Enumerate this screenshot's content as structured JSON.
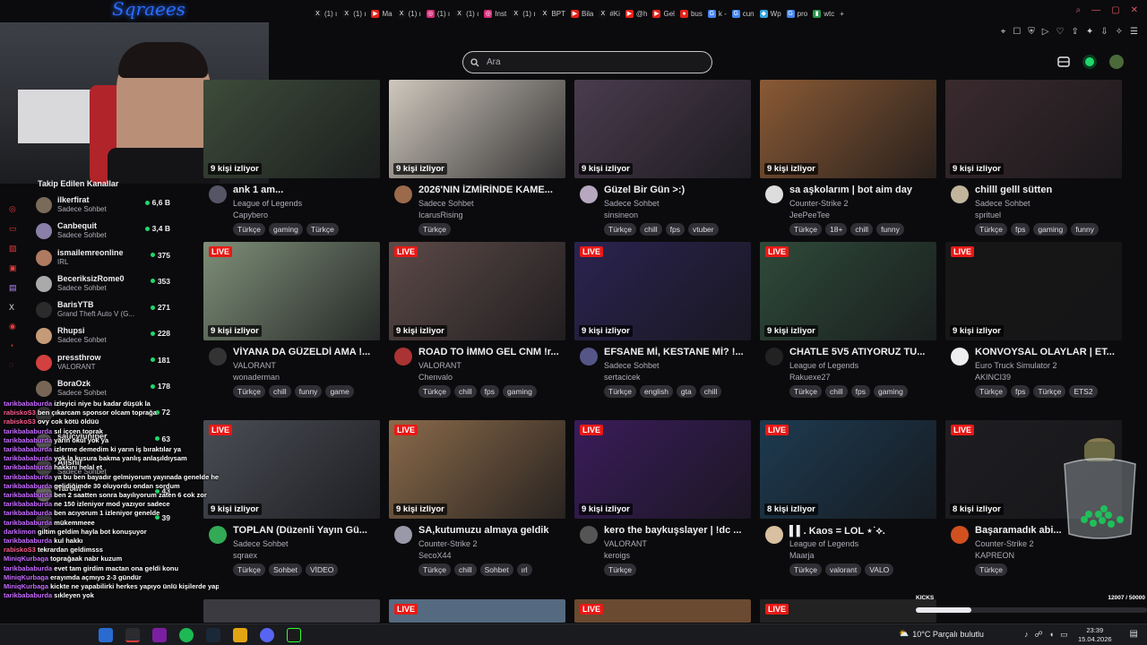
{
  "overlay": {
    "logo_text": "Sqraees"
  },
  "browser_tabs": [
    {
      "label": "(1) ı",
      "fav": "X",
      "color": "#111"
    },
    {
      "label": "(1) ı",
      "fav": "X",
      "color": "#111"
    },
    {
      "label": "Ma",
      "fav": "▶",
      "color": "#e62117"
    },
    {
      "label": "(1) ı",
      "fav": "X",
      "color": "#111"
    },
    {
      "label": "(1) ı",
      "fav": "◎",
      "color": "#d62976"
    },
    {
      "label": "(1) ı",
      "fav": "X",
      "color": "#111"
    },
    {
      "label": "Inst",
      "fav": "◎",
      "color": "#d62976"
    },
    {
      "label": "(1) ı",
      "fav": "X",
      "color": "#111"
    },
    {
      "label": "BPT",
      "fav": "X",
      "color": "#111"
    },
    {
      "label": "Bila",
      "fav": "▶",
      "color": "#e62117"
    },
    {
      "label": "#Ki",
      "fav": "X",
      "color": "#111"
    },
    {
      "label": "@h",
      "fav": "▶",
      "color": "#e62117"
    },
    {
      "label": "Gel",
      "fav": "▶",
      "color": "#e62117"
    },
    {
      "label": "bus",
      "fav": "●",
      "color": "#e62117"
    },
    {
      "label": "k -",
      "fav": "G",
      "color": "#4285f4"
    },
    {
      "label": "cun",
      "fav": "G",
      "color": "#4285f4"
    },
    {
      "label": "Wp",
      "fav": "◆",
      "color": "#33a3dc"
    },
    {
      "label": "pro",
      "fav": "G",
      "color": "#4285f4"
    },
    {
      "label": "wtc",
      "fav": "▮",
      "color": "#2b9348"
    }
  ],
  "search": {
    "placeholder": "Ara"
  },
  "followed": {
    "title": "Takip Edilen Kanallar",
    "channels": [
      {
        "name": "ilkerfirat",
        "category": "Sadece Sohbet",
        "viewers": "6,6 B",
        "color": "#7a6a5a"
      },
      {
        "name": "Canbequit",
        "category": "Sadece Sohbet",
        "viewers": "3,4 B",
        "color": "#8a7fa8"
      },
      {
        "name": "ismailemreonline",
        "category": "IRL",
        "viewers": "375",
        "color": "#b07a60"
      },
      {
        "name": "BeceriksizRome0",
        "category": "Sadece Sohbet",
        "viewers": "353",
        "color": "#aaaaaa"
      },
      {
        "name": "BarisYTB",
        "category": "Grand Theft Auto V (G...",
        "viewers": "271",
        "color": "#2b2b2b"
      },
      {
        "name": "Rhupsi",
        "category": "Sadece Sohbet",
        "viewers": "228",
        "color": "#c59a78"
      },
      {
        "name": "pressthrow",
        "category": "VALORANT",
        "viewers": "181",
        "color": "#d24040"
      },
      {
        "name": "BoraOzk",
        "category": "Sadece Sohbet",
        "viewers": "178",
        "color": "#776655"
      },
      {
        "name": "",
        "category": "",
        "viewers": "72",
        "color": "#333"
      },
      {
        "name": "saucyjuniper",
        "category": "",
        "viewers": "63",
        "color": "#555"
      },
      {
        "name": "Alisnir",
        "category": "Sadece Sohbet",
        "viewers": "",
        "color": "#444"
      },
      {
        "name": "Tarcin",
        "category": "",
        "viewers": "43",
        "color": "#666"
      },
      {
        "name": "",
        "category": "",
        "viewers": "39",
        "color": "#333"
      }
    ]
  },
  "streams": [
    {
      "live": false,
      "viewers": "9 kişi izliyor",
      "title": "ank 1 am...",
      "category": "League of Legends",
      "channel": "Capybero",
      "tags": [
        "Türkçe",
        "gaming",
        "Türkçe"
      ],
      "thumb": "#3d4c3a",
      "avatar": "#556"
    },
    {
      "live": false,
      "viewers": "9 kişi izliyor",
      "title": "2026'NIN İZMİRİNDE KAME...",
      "category": "Sadece Sohbet",
      "channel": "IcarusRising",
      "tags": [
        "Türkçe"
      ],
      "thumb": "#cfc8bd",
      "avatar": "#9a6a4a"
    },
    {
      "live": false,
      "viewers": "9 kişi izliyor",
      "title": "Güzel Bir Gün >:)",
      "category": "Sadece Sohbet",
      "channel": "sinsineon",
      "tags": [
        "Türkçe",
        "chill",
        "fps",
        "vtuber"
      ],
      "thumb": "#4a3c4e",
      "avatar": "#b7a8c0"
    },
    {
      "live": false,
      "viewers": "9 kişi izliyor",
      "title": "sa aşkolarım | bot aim day",
      "category": "Counter-Strike 2",
      "channel": "JeePeeTee",
      "tags": [
        "Türkçe",
        "18+",
        "chill",
        "funny"
      ],
      "thumb": "#8a5a35",
      "avatar": "#ddd"
    },
    {
      "live": false,
      "viewers": "9 kişi izliyor",
      "title": "chilll gelll sütten",
      "category": "Sadece Sohbet",
      "channel": "sprituel",
      "tags": [
        "Türkçe",
        "fps",
        "gaming",
        "funny"
      ],
      "thumb": "#3a2a2e",
      "avatar": "#c2b59b"
    },
    {
      "live": true,
      "viewers": "9 kişi izliyor",
      "title": "VİYANA DA GÜZELDİ AMA !...",
      "category": "VALORANT",
      "channel": "wonaderman",
      "tags": [
        "Türkçe",
        "chill",
        "funny",
        "game"
      ],
      "thumb": "#7e8f78",
      "avatar": "#333"
    },
    {
      "live": true,
      "viewers": "9 kişi izliyor",
      "title": "ROAD TO İMMO GEL CNM !r...",
      "category": "VALORANT",
      "channel": "Chenvalo",
      "tags": [
        "Türkçe",
        "chill",
        "fps",
        "gaming"
      ],
      "thumb": "#5c4a48",
      "avatar": "#a33"
    },
    {
      "live": true,
      "viewers": "9 kişi izliyor",
      "title": "EFSANE Mİ, KESTANE Mİ? !...",
      "category": "Sadece Sohbet",
      "channel": "sertacicek",
      "tags": [
        "Türkçe",
        "english",
        "gta",
        "chill"
      ],
      "thumb": "#2b2350",
      "avatar": "#558"
    },
    {
      "live": true,
      "viewers": "9 kişi izliyor",
      "title": "CHATLE 5V5 ATIYORUZ TU...",
      "category": "League of Legends",
      "channel": "Rakuexe27",
      "tags": [
        "Türkçe",
        "chill",
        "fps",
        "gaming"
      ],
      "thumb": "#2f4a3a",
      "avatar": "#222"
    },
    {
      "live": true,
      "viewers": "9 kişi izliyor",
      "title": "KONVOYSAL OLAYLAR | ET...",
      "category": "Euro Truck Simulator 2",
      "channel": "AKINCI39",
      "tags": [
        "Türkçe",
        "fps",
        "Türkçe",
        "ETS2"
      ],
      "thumb": "#161616",
      "avatar": "#eee"
    },
    {
      "live": true,
      "viewers": "9 kişi izliyor",
      "title": "TOPLAN (Düzenli Yayın Gü...",
      "category": "Sadece Sohbet",
      "channel": "sqraex",
      "tags": [
        "Türkçe",
        "Sohbet",
        "VİDEO"
      ],
      "thumb": "#4a4d55",
      "avatar": "#3a5"
    },
    {
      "live": true,
      "viewers": "9 kişi izliyor",
      "title": "SA,kutumuzu almaya geldik",
      "category": "Counter-Strike 2",
      "channel": "SecoX44",
      "tags": [
        "Türkçe",
        "chill",
        "Sohbet",
        "ırl"
      ],
      "thumb": "#8a6a4a",
      "avatar": "#99a"
    },
    {
      "live": true,
      "viewers": "9 kişi izliyor",
      "title": "kero the baykuşslayer | !dc ...",
      "category": "VALORANT",
      "channel": "keroigs",
      "tags": [
        "Türkçe"
      ],
      "thumb": "#3a1c5a",
      "avatar": "#555"
    },
    {
      "live": true,
      "viewers": "8 kişi izliyor",
      "title": "▌▌. Kaos = LOL ⋆˙⟡.",
      "category": "League of Legends",
      "channel": "Maarja",
      "tags": [
        "Türkçe",
        "valorant",
        "VALO"
      ],
      "thumb": "#1d3a50",
      "avatar": "#d8c0a0"
    },
    {
      "live": true,
      "viewers": "8 kişi izliyor",
      "title": "Başaramadık abi...",
      "category": "Counter-Strike 2",
      "channel": "KAPREON",
      "tags": [
        "Türkçe"
      ],
      "thumb": "#1e1e22",
      "avatar": "#d05020"
    }
  ],
  "bottom_row_live": [
    "LIVE",
    "LIVE",
    "LIVE",
    "LIVE"
  ],
  "chat": [
    {
      "user": "tarikbababurda",
      "msg": "izleyici niye bu kadar düşük la"
    },
    {
      "user": "rabiskoS3",
      "msg": "ben çıkarcam sponsor olcam toprağa"
    },
    {
      "user": "rabiskoS3",
      "msg": "ovy cok kötü öldüü"
    },
    {
      "user": "tarikbababurda",
      "msg": "sıl iççen toprak"
    },
    {
      "user": "tarikbababurda",
      "msg": "yarın okul yok ya"
    },
    {
      "user": "tarikbababurda",
      "msg": "izlerme demedim ki yarın iş bıraktılar ya"
    },
    {
      "user": "tarikbababurda",
      "msg": "yok la kusura bakma yanlış anlaşıldıysam"
    },
    {
      "user": "tarikbababurda",
      "msg": "hakkını helal et"
    },
    {
      "user": "tarikbababurda",
      "msg": "ya bu ben bayadır gelmiyorum yayınada genelde her"
    },
    {
      "user": "tarikbababurda",
      "msg": "gelidiğimde 30 oluyordu ondan sordum"
    },
    {
      "user": "tarikbababurda",
      "msg": "ben 2 saatten sonra bayılıyorum zaten 6 cok zor"
    },
    {
      "user": "tarikbababurda",
      "msg": "ne 150 izleniyor mod yazıyor sadece"
    },
    {
      "user": "tarikbababurda",
      "msg": "ben acıyorum 1 izleniyor genelde"
    },
    {
      "user": "tarikbababurda",
      "msg": "mükemmeee"
    },
    {
      "user": "darklimon",
      "msg": "giltim geldim hayla bot konuşuyor"
    },
    {
      "user": "tarikbababurda",
      "msg": "kul hakkı"
    },
    {
      "user": "rabiskoS3",
      "msg": "tekrardan geldimsss"
    },
    {
      "user": "MiniqKurbaga",
      "msg": "toprağaak nabr kuzum"
    },
    {
      "user": "tarikbababurda",
      "msg": "evet tam girdim mactan ona geldi konu"
    },
    {
      "user": "MiniqKurbaga",
      "msg": "erayımda açmıyo 2-3 gündür"
    },
    {
      "user": "MiniqKurbaga",
      "msg": "kickte ne yapabilirki herkes yapıyo ünlü kişilerde yapıyo"
    },
    {
      "user": "tarikbababurda",
      "msg": "sıkleyen yok"
    }
  ],
  "meter": {
    "label": "KICKS",
    "count": "12007 / 50000",
    "level": 0.24
  },
  "taskbar": {
    "weather": "10°C  Parçalı bulutlu",
    "time": "23:39",
    "date": "15.04.2026"
  }
}
